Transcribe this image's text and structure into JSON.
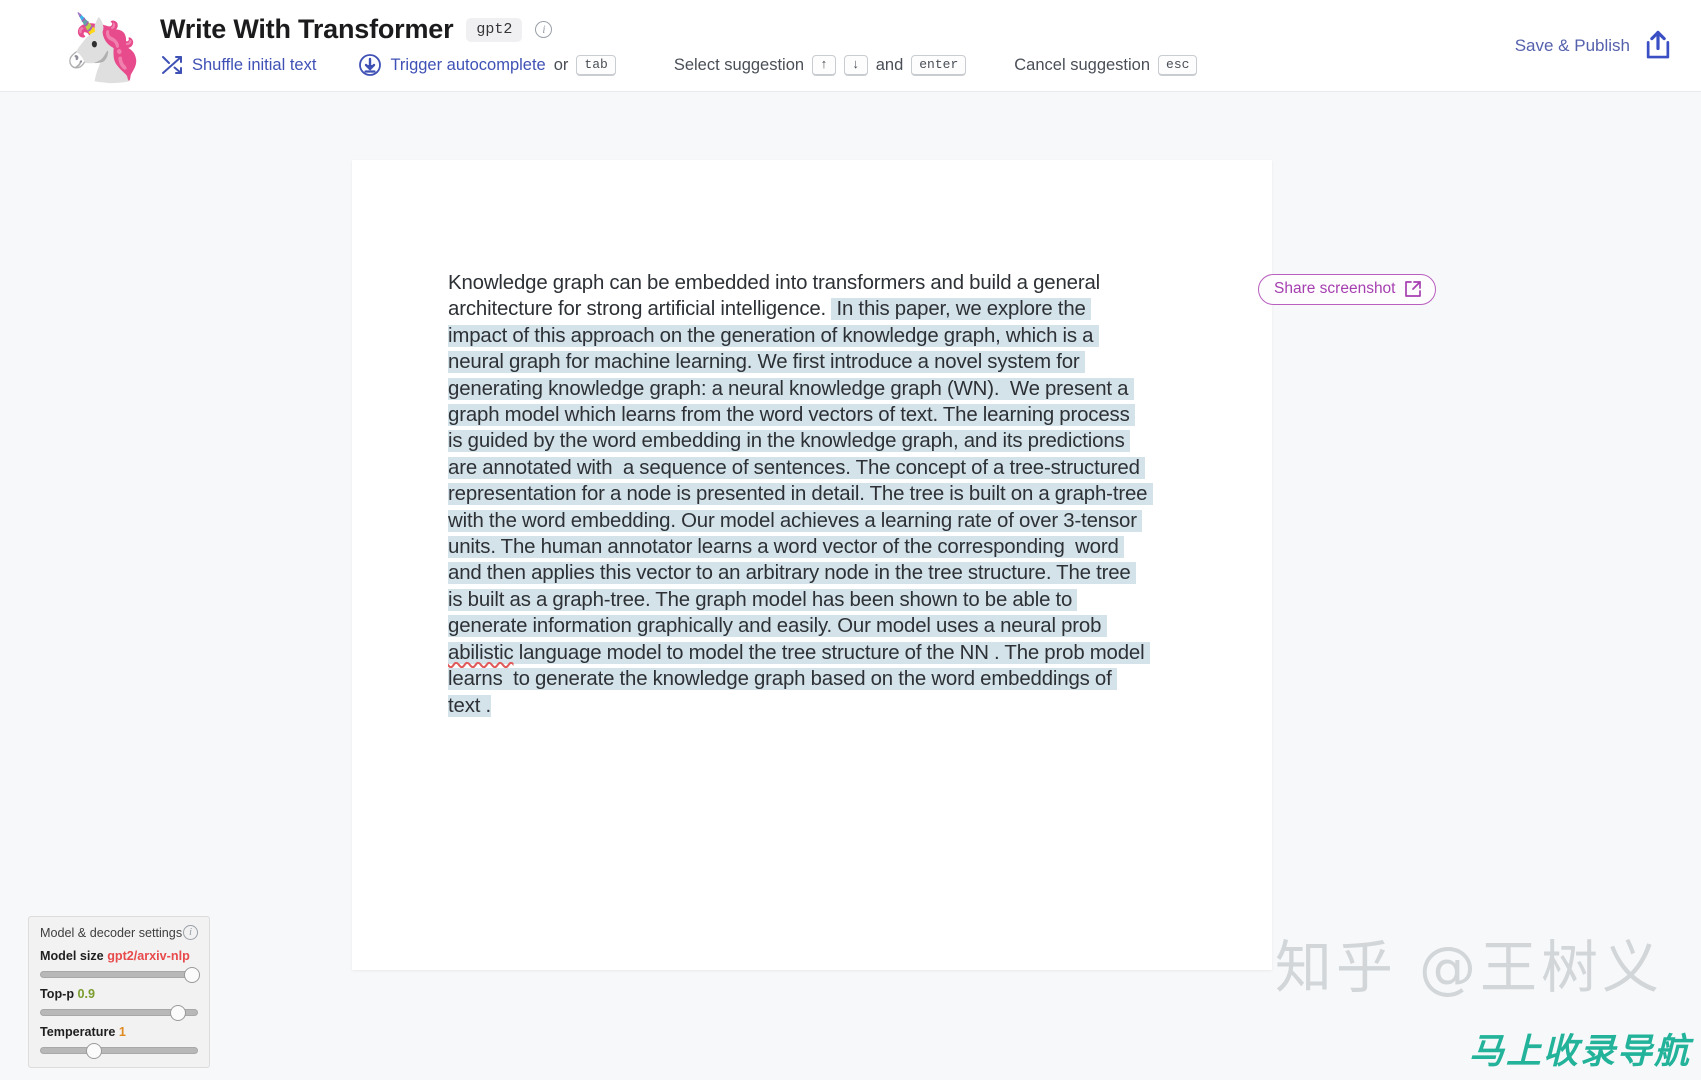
{
  "header": {
    "logo_icon": "unicorn-emoji",
    "logo_glyph": "🦄",
    "title": "Write With Transformer",
    "model_badge": "gpt2",
    "info_icon": "info-icon",
    "shortcuts": [
      {
        "icon": "shuffle-icon",
        "action": "Shuffle initial text",
        "connector": "",
        "keys": []
      },
      {
        "icon": "download-arrow-icon",
        "action": "Trigger autocomplete",
        "connector": "or",
        "keys": [
          "tab"
        ]
      },
      {
        "icon": "",
        "action": "Select suggestion",
        "connector": "and",
        "keys": [
          "↑",
          "↓"
        ],
        "keys_after": [
          "enter"
        ]
      },
      {
        "icon": "",
        "action": "Cancel suggestion",
        "connector": "",
        "keys": [
          "esc"
        ]
      }
    ],
    "save_publish_label": "Save & Publish",
    "save_publish_icon": "share-upload-icon"
  },
  "editor": {
    "prompt_text": "Knowledge graph can be embedded into transformers and build a general architecture for strong artificial intelligence. ",
    "generated_text_part1": " In this paper, we explore the impact of this approach on the generation of knowledge graph, which is a neural graph for machine learning. We first introduce a novel system for generating knowledge graph: a neural knowledge graph (WN).  We present a graph model which learns from the word vectors of text. The learning process is guided by the word embedding in the knowledge graph, and its predictions are annotated with  a sequence of sentences. The concept of a tree-structured representation for a node is presented in detail. The tree is built on a graph-tree with the word embedding. Our model achieves a learning rate of over 3-tensor units. The human annotator learns a word vector of the corresponding  word and then applies this vector to an arbitrary node in the tree structure. The tree is built as a graph-tree. The graph model has been shown to be able to generate information graphically and easily. Our model uses a neural prob ",
    "misspelled_word": "abilistic",
    "generated_text_part2": " language model to model the tree structure of the NN . The prob model learns  to generate the knowledge graph based on the word embeddings of text .",
    "highlight_color": "#d4e3ea",
    "spellcheck_underline_color": "#e05a5a"
  },
  "share_button": {
    "label": "Share screenshot",
    "icon": "external-link-icon",
    "accent_color": "#a63fb0"
  },
  "settings": {
    "panel_title": "Model & decoder settings",
    "info_icon": "info-icon",
    "controls": [
      {
        "label": "Model size",
        "value": "gpt2/arxiv-nlp",
        "value_color": "#e8494b",
        "knob_percent": 97
      },
      {
        "label": "Top-p",
        "value": "0.9",
        "value_color": "#7a9d2e",
        "knob_percent": 88
      },
      {
        "label": "Temperature",
        "value": "1",
        "value_color": "#e08a22",
        "knob_percent": 34
      }
    ]
  },
  "watermarks": {
    "zhihu": "知乎 @王树义",
    "nav": "马上收录导航",
    "nav_color": "#22b39a"
  }
}
